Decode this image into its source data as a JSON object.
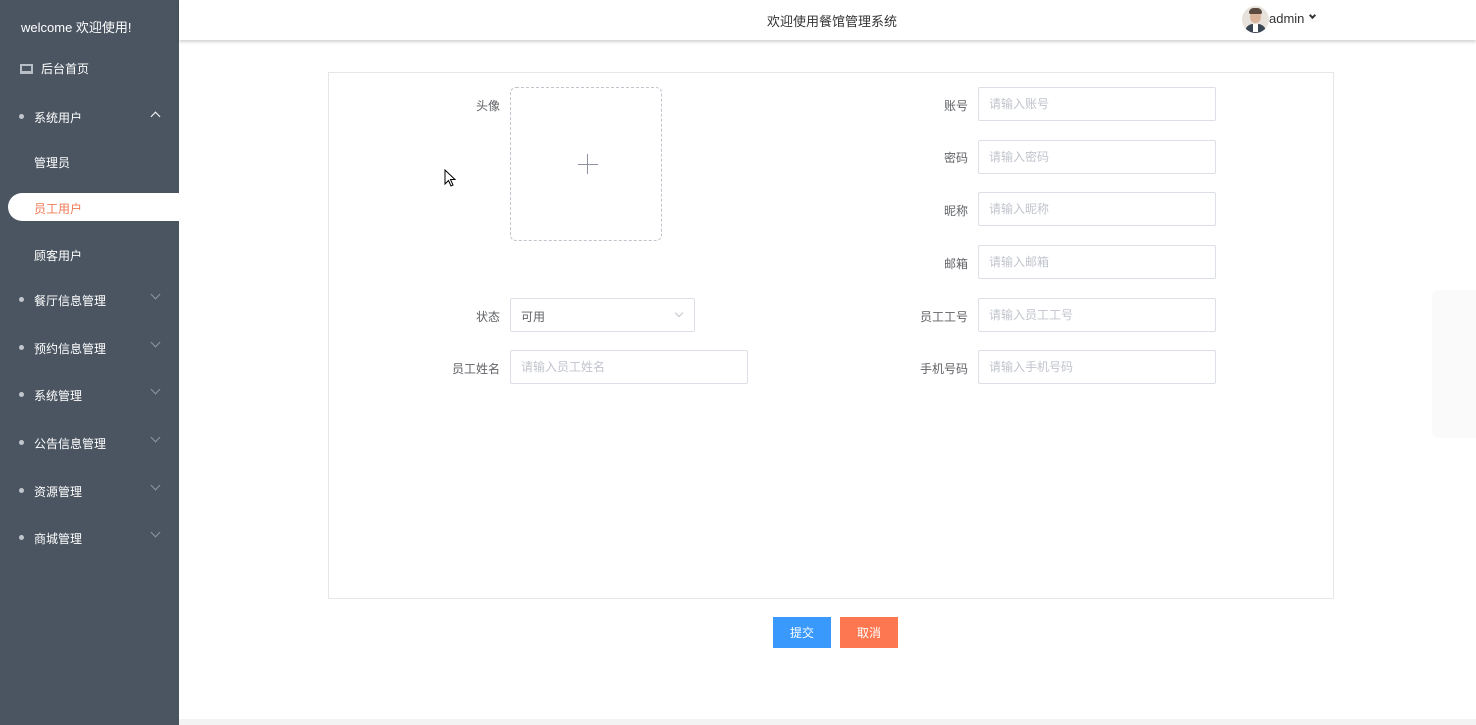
{
  "sidebar": {
    "welcome": "welcome 欢迎使用!",
    "home": "后台首页",
    "groups": [
      {
        "label": "系统用户",
        "expanded": true
      },
      {
        "label": "餐厅信息管理"
      },
      {
        "label": "预约信息管理"
      },
      {
        "label": "系统管理"
      },
      {
        "label": "公告信息管理"
      },
      {
        "label": "资源管理"
      },
      {
        "label": "商城管理"
      }
    ],
    "submenu": [
      "管理员",
      "员工用户",
      "顾客用户"
    ],
    "active_submenu": "员工用户"
  },
  "header": {
    "title": "欢迎使用餐馆管理系统",
    "user": "admin"
  },
  "form": {
    "avatar_label": "头像",
    "status_label": "状态",
    "status_value": "可用",
    "name_label": "员工姓名",
    "name_placeholder": "请输入员工姓名",
    "account_label": "账号",
    "account_placeholder": "请输入账号",
    "password_label": "密码",
    "password_placeholder": "请输入密码",
    "nickname_label": "昵称",
    "nickname_placeholder": "请输入昵称",
    "email_label": "邮箱",
    "email_placeholder": "请输入邮箱",
    "empno_label": "员工工号",
    "empno_placeholder": "请输入员工工号",
    "phone_label": "手机号码",
    "phone_placeholder": "请输入手机号码"
  },
  "actions": {
    "submit": "提交",
    "cancel": "取消"
  },
  "colors": {
    "sidebar_bg": "#4a5561",
    "active_text": "#ef7a55",
    "submit_bg": "#3a99fd",
    "cancel_bg": "#fd7850"
  }
}
